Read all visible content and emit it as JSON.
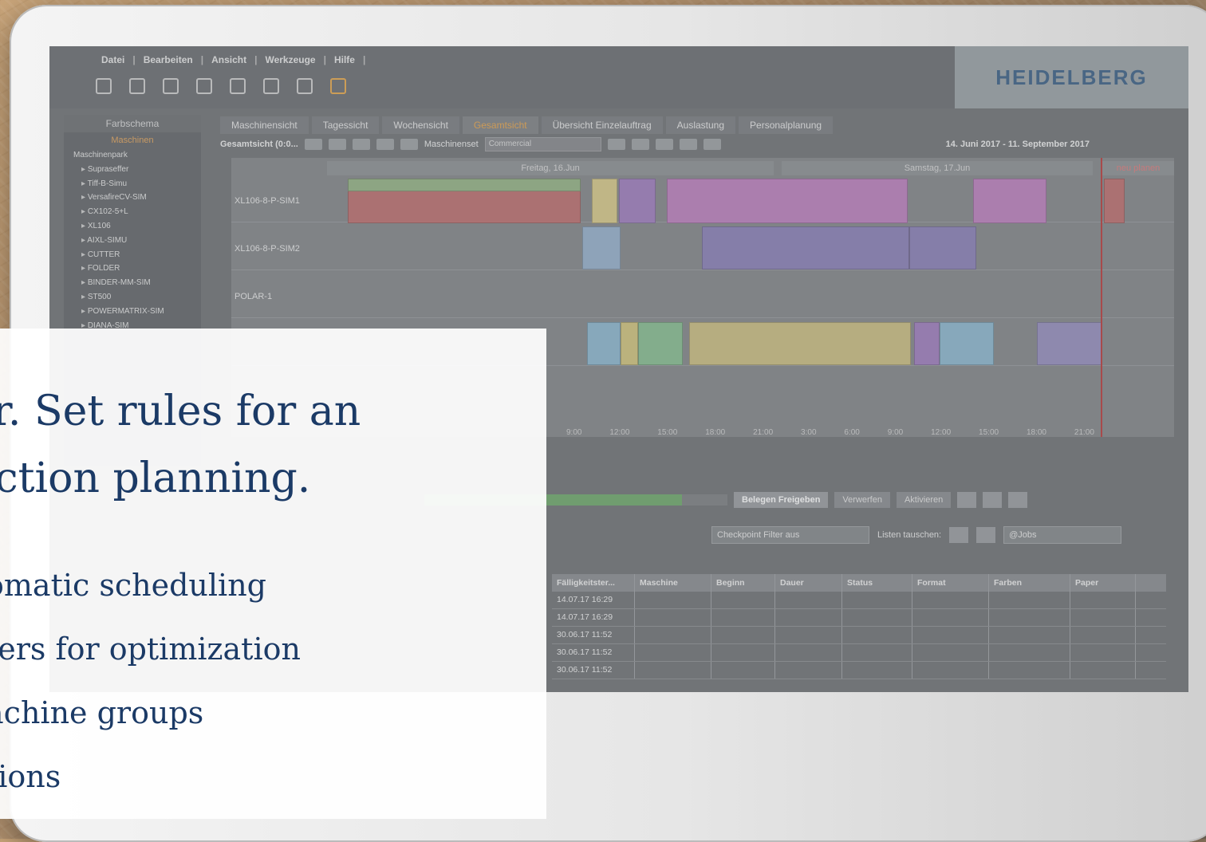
{
  "menu": {
    "items": [
      "Datei",
      "Bearbeiten",
      "Ansicht",
      "Werkzeuge",
      "Hilfe"
    ]
  },
  "brand": {
    "logo_text": "HEIDELBERG",
    "logo_color": "#3a5f86"
  },
  "left_panel": {
    "title": "Farbschema",
    "subtitle": "Maschinen",
    "root": "Maschinenpark",
    "items": [
      "Supraseffer",
      "Tiff-B-Simu",
      "VersafireCV-SIM",
      "CX102-5+L",
      "XL106",
      "AIXL-SIMU",
      "CUTTER",
      "FOLDER",
      "BINDER-MM-SIM",
      "ST500",
      "POWERMATRIX-SIM",
      "DIANA-SIM"
    ]
  },
  "tabs": [
    "Maschinensicht",
    "Tagessicht",
    "Wochensicht",
    "Gesamtsicht",
    "Übersicht Einzelauftrag",
    "Auslastung",
    "Personalplanung"
  ],
  "active_tab": "Gesamtsicht",
  "gantt_toolbar": {
    "title": "Gesamtsicht  (0:0...",
    "machineset_label": "Maschinenset",
    "machineset_value": "Commercial",
    "date_range": "14. Juni 2017  -  11. September 2017"
  },
  "gantt": {
    "days": [
      "Freitag, 16.Jun",
      "Samstag, 17.Jun"
    ],
    "rows": [
      "XL106-8-P-SIM1",
      "XL106-8-P-SIM2",
      "POLAR-1"
    ],
    "replan_label": "neu planen",
    "times": [
      "9:00",
      "12:00",
      "15:00",
      "18:00",
      "21:00",
      "3:00",
      "6:00",
      "9:00",
      "12:00",
      "15:00",
      "18:00",
      "21:00"
    ]
  },
  "actions": {
    "progress": 0.85,
    "release": "Belegen Freigeben",
    "discard": "Verwerfen",
    "activate": "Aktivieren"
  },
  "filters": {
    "checkpoint": "Checkpoint Filter aus",
    "swap_label": "Listen tauschen:",
    "list": "@Jobs"
  },
  "table": {
    "columns": [
      "Fälligkeitster...",
      "Maschine",
      "Beginn",
      "Dauer",
      "Status",
      "Format",
      "Farben",
      "Paper"
    ],
    "rows": [
      [
        "14.07.17 16:29",
        "",
        "",
        "",
        "",
        "",
        "",
        ""
      ],
      [
        "14.07.17 16:29",
        "",
        "",
        "",
        "",
        "",
        "",
        ""
      ],
      [
        "30.06.17 11:52",
        "",
        "",
        "",
        "",
        "",
        "",
        ""
      ],
      [
        "30.06.17 11:52",
        "",
        "",
        "",
        "",
        "",
        "",
        ""
      ],
      [
        "30.06.17 11:52",
        "",
        "",
        "",
        "",
        "",
        "",
        ""
      ]
    ]
  },
  "overlay": {
    "headline_lines": [
      "er. Set rules for an",
      "uction planning."
    ],
    "bullets": [
      "omatic scheduling",
      "ters for  optimization",
      "achine groups",
      "tions"
    ],
    "text_color": "#1b3a66"
  }
}
